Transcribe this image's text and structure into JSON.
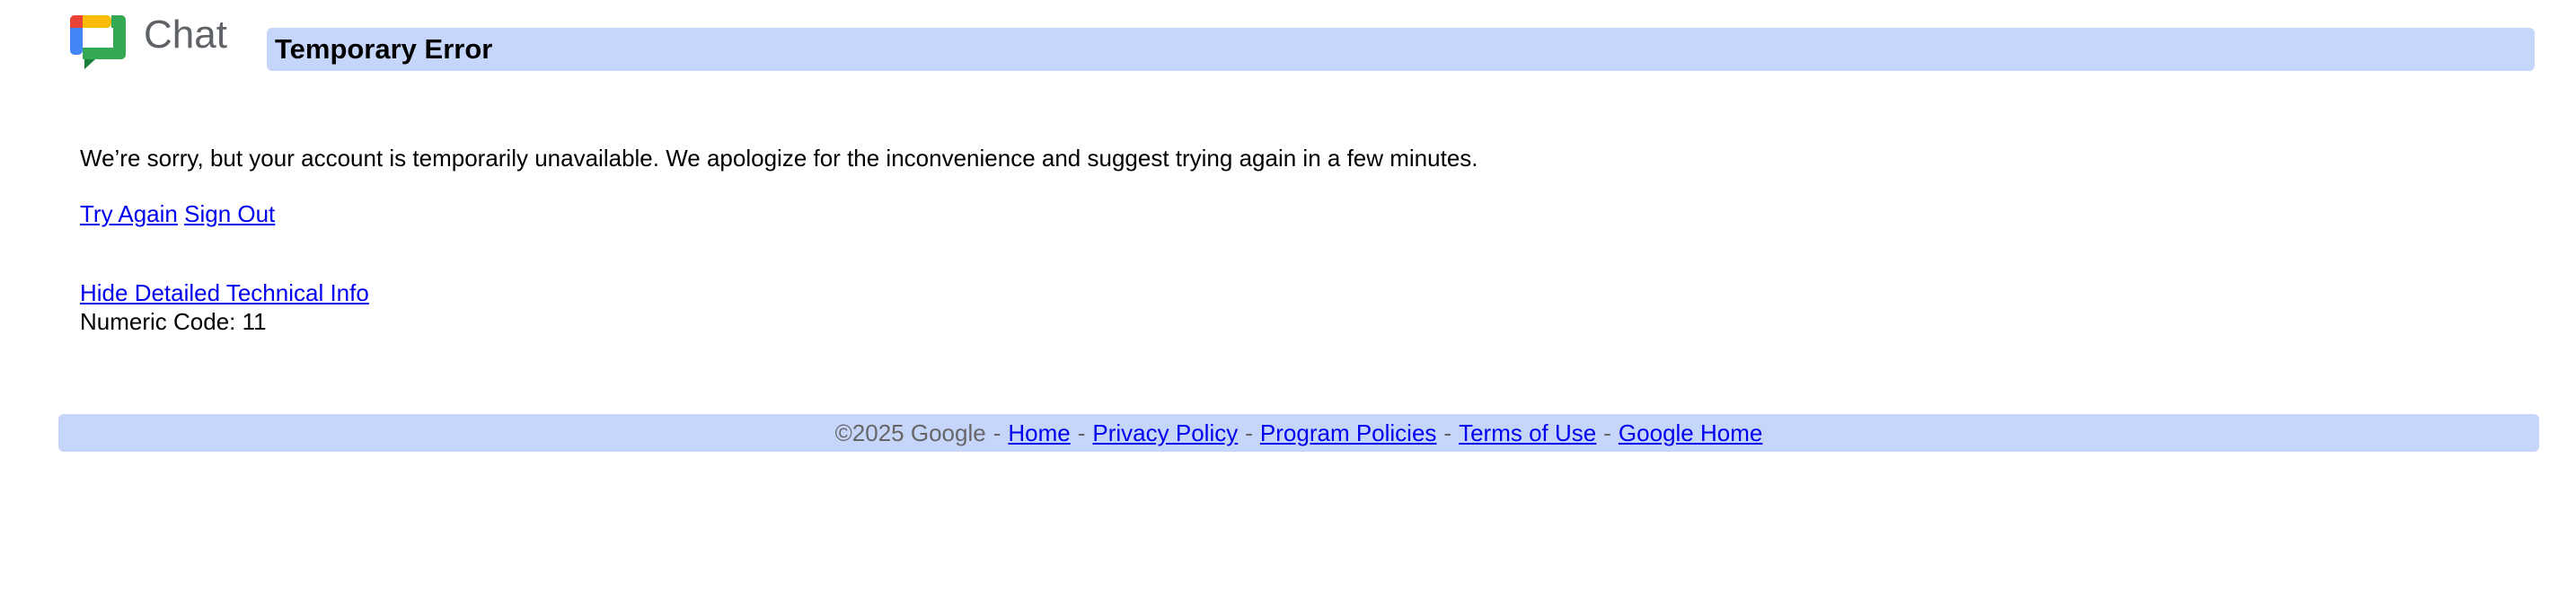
{
  "header": {
    "logo_text": "Chat",
    "title": "Temporary Error"
  },
  "main": {
    "message": "We’re sorry, but your account is temporarily unavailable. We apologize for the inconvenience and suggest trying again in a few minutes.",
    "try_again_label": "Try Again",
    "sign_out_label": "Sign Out",
    "toggle_tech_info_label": "Hide Detailed Technical Info",
    "numeric_code_text": "Numeric Code: 11"
  },
  "footer": {
    "copyright": "©2025 Google",
    "separator": "-",
    "links": {
      "home": "Home",
      "privacy": "Privacy Policy",
      "program_policies": "Program Policies",
      "terms": "Terms of Use",
      "google_home": "Google Home"
    }
  },
  "colors": {
    "bar_background": "#c6d6fb",
    "link": "#0000ee",
    "muted_text": "#666666"
  },
  "icons": {
    "logo": "google-chat-logo-icon"
  }
}
